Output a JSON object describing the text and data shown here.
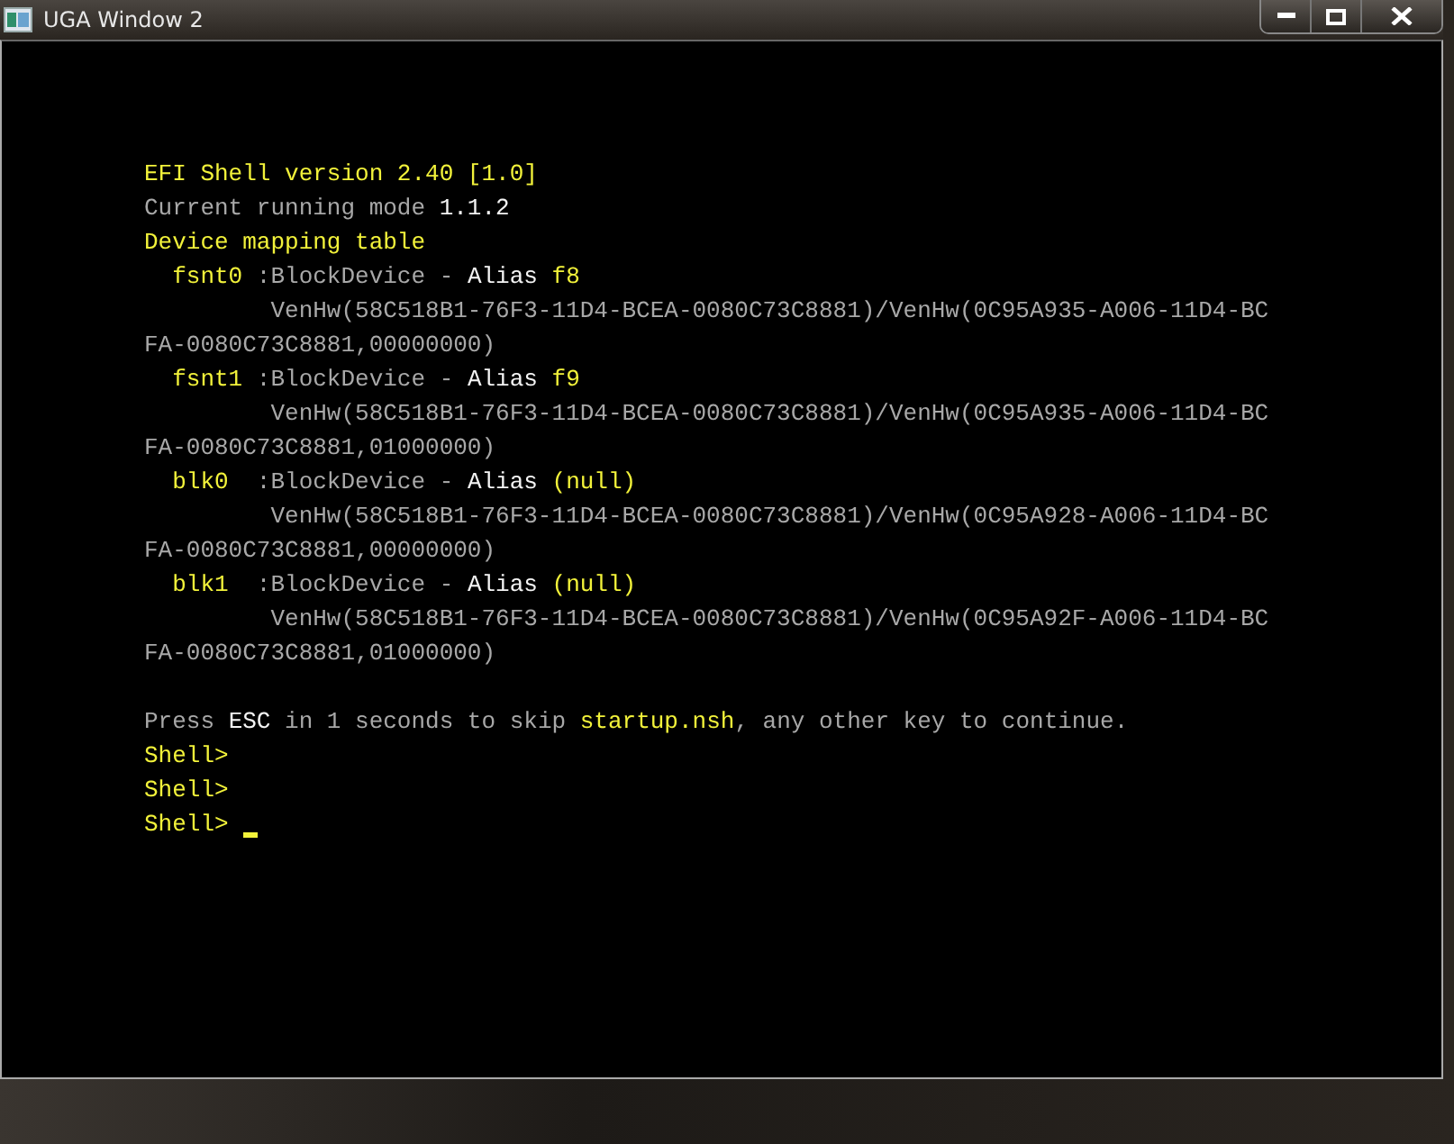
{
  "window": {
    "title": "UGA Window 2"
  },
  "console": {
    "lines": [
      {
        "segments": [
          {
            "text": "EFI Shell version 2.40 [1.0]",
            "color": "#f2f23a"
          }
        ]
      },
      {
        "segments": [
          {
            "text": "Current running mode ",
            "color": "#a8a8a8"
          },
          {
            "text": "1.1.2",
            "color": "#f4f4f4"
          }
        ]
      },
      {
        "segments": [
          {
            "text": "Device mapping table",
            "color": "#f2f23a"
          }
        ]
      },
      {
        "segments": [
          {
            "text": "  fsnt0 ",
            "color": "#f2f23a"
          },
          {
            "text": ":BlockDevice - ",
            "color": "#a8a8a8"
          },
          {
            "text": "Alias ",
            "color": "#f4f4f4"
          },
          {
            "text": "f8",
            "color": "#f2f23a"
          }
        ]
      },
      {
        "segments": [
          {
            "text": "         VenHw(58C518B1-76F3-11D4-BCEA-0080C73C8881)/VenHw(0C95A935-A006-11D4-BC",
            "color": "#a8a8a8"
          }
        ]
      },
      {
        "segments": [
          {
            "text": "FA-0080C73C8881,00000000)",
            "color": "#a8a8a8"
          }
        ]
      },
      {
        "segments": [
          {
            "text": "  fsnt1 ",
            "color": "#f2f23a"
          },
          {
            "text": ":BlockDevice - ",
            "color": "#a8a8a8"
          },
          {
            "text": "Alias ",
            "color": "#f4f4f4"
          },
          {
            "text": "f9",
            "color": "#f2f23a"
          }
        ]
      },
      {
        "segments": [
          {
            "text": "         VenHw(58C518B1-76F3-11D4-BCEA-0080C73C8881)/VenHw(0C95A935-A006-11D4-BC",
            "color": "#a8a8a8"
          }
        ]
      },
      {
        "segments": [
          {
            "text": "FA-0080C73C8881,01000000)",
            "color": "#a8a8a8"
          }
        ]
      },
      {
        "segments": [
          {
            "text": "  blk0  ",
            "color": "#f2f23a"
          },
          {
            "text": ":BlockDevice - ",
            "color": "#a8a8a8"
          },
          {
            "text": "Alias ",
            "color": "#f4f4f4"
          },
          {
            "text": "(null)",
            "color": "#f2f23a"
          }
        ]
      },
      {
        "segments": [
          {
            "text": "         VenHw(58C518B1-76F3-11D4-BCEA-0080C73C8881)/VenHw(0C95A928-A006-11D4-BC",
            "color": "#a8a8a8"
          }
        ]
      },
      {
        "segments": [
          {
            "text": "FA-0080C73C8881,00000000)",
            "color": "#a8a8a8"
          }
        ]
      },
      {
        "segments": [
          {
            "text": "  blk1  ",
            "color": "#f2f23a"
          },
          {
            "text": ":BlockDevice - ",
            "color": "#a8a8a8"
          },
          {
            "text": "Alias ",
            "color": "#f4f4f4"
          },
          {
            "text": "(null)",
            "color": "#f2f23a"
          }
        ]
      },
      {
        "segments": [
          {
            "text": "         VenHw(58C518B1-76F3-11D4-BCEA-0080C73C8881)/VenHw(0C95A92F-A006-11D4-BC",
            "color": "#a8a8a8"
          }
        ]
      },
      {
        "segments": [
          {
            "text": "FA-0080C73C8881,01000000)",
            "color": "#a8a8a8"
          }
        ]
      },
      {
        "blank_before": true,
        "segments": [
          {
            "text": "Press ",
            "color": "#a8a8a8"
          },
          {
            "text": "ESC",
            "color": "#f4f4f4"
          },
          {
            "text": " in 1 seconds to skip ",
            "color": "#a8a8a8"
          },
          {
            "text": "startup.nsh",
            "color": "#f2f23a"
          },
          {
            "text": ", any other key to continue.",
            "color": "#a8a8a8"
          }
        ]
      },
      {
        "segments": [
          {
            "text": "Shell>",
            "color": "#f2f23a"
          }
        ]
      },
      {
        "segments": [
          {
            "text": "Shell>",
            "color": "#f2f23a"
          }
        ]
      },
      {
        "cursor": true,
        "segments": [
          {
            "text": "Shell> ",
            "color": "#f2f23a"
          }
        ]
      }
    ]
  }
}
